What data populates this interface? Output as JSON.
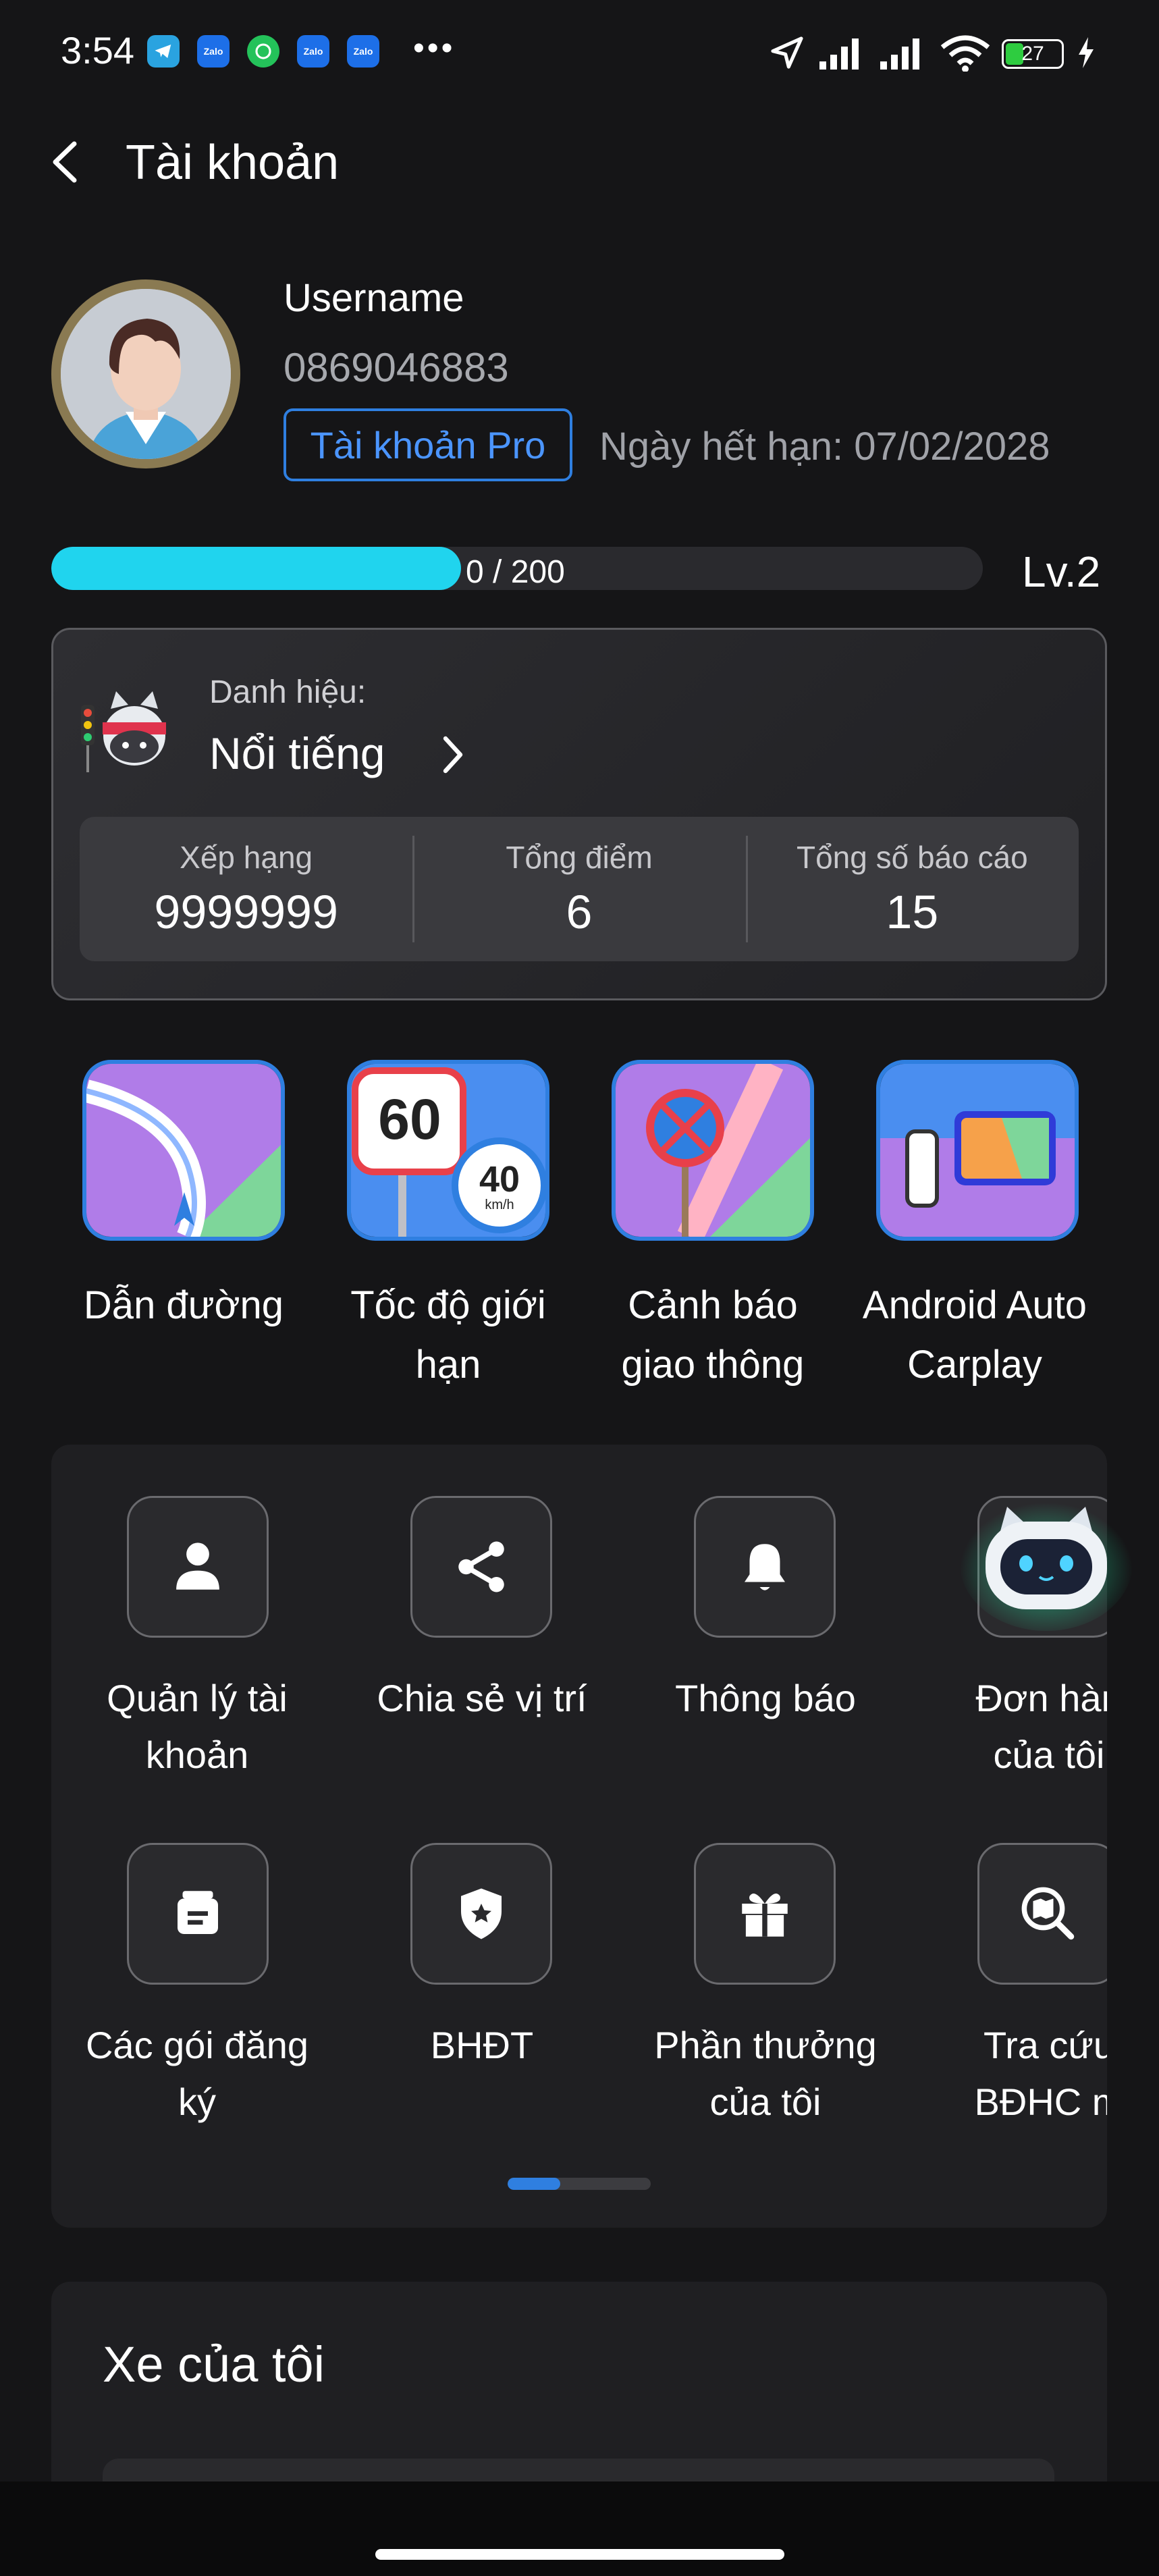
{
  "status_bar": {
    "time": "3:54",
    "notifications": [
      "Telegram",
      "Zalo",
      "WhatsApp",
      "Zalo",
      "Zalo"
    ],
    "notif_zalo_text": "Zalo",
    "more": "•••",
    "battery": "27"
  },
  "header": {
    "title": "Tài khoản"
  },
  "profile": {
    "username": "Username",
    "phone": "0869046883",
    "account_type": "Tài khoản Pro",
    "expiry": "Ngày hết hạn: 07/02/2028"
  },
  "progress": {
    "text": "0 / 200",
    "fraction": 0.44,
    "level": "Lv.2"
  },
  "title_card": {
    "label": "Danh hiệu:",
    "rank_name": "Nổi tiếng",
    "stats": [
      {
        "label": "Xếp hạng",
        "value": "9999999"
      },
      {
        "label": "Tổng điểm",
        "value": "6"
      },
      {
        "label": "Tổng số báo cáo",
        "value": "15"
      }
    ]
  },
  "features": [
    {
      "label1": "Dẫn đường",
      "label2": ""
    },
    {
      "label1": "Tốc độ giới",
      "label2": "hạn",
      "big_sign": "60",
      "small_sign": "40",
      "unit": "km/h"
    },
    {
      "label1": "Cảnh báo",
      "label2": "giao thông"
    },
    {
      "label1": "Android Auto",
      "label2": "Carplay"
    }
  ],
  "menu": {
    "row1": [
      {
        "label1": "Quản lý tài",
        "label2": "khoản"
      },
      {
        "label1": "Chia sẻ vị trí",
        "label2": ""
      },
      {
        "label1": "Thông báo",
        "label2": ""
      },
      {
        "label1": "Đơn hàn",
        "label2": "của tôi"
      }
    ],
    "row2": [
      {
        "label1": "Các gói đăng",
        "label2": "ký"
      },
      {
        "label1": "BHĐT",
        "label2": ""
      },
      {
        "label1": "Phần thưởng",
        "label2": "của tôi"
      },
      {
        "label1": "Tra cứu",
        "label2": "BĐHC m"
      }
    ],
    "page_fraction": 0.37
  },
  "vehicle": {
    "title": "Xe của tôi"
  },
  "colors": {
    "accent": "#2f7fe0",
    "progress": "#20d4ee",
    "background": "#151517"
  }
}
